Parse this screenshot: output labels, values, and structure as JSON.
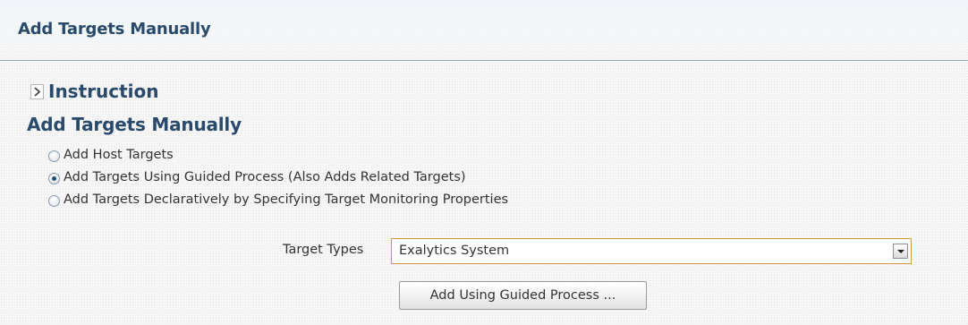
{
  "header": {
    "title": "Add Targets Manually"
  },
  "instruction": {
    "label": "Instruction",
    "icon": "chevron-right-icon"
  },
  "section": {
    "title": "Add Targets Manually"
  },
  "options": [
    {
      "label": "Add Host Targets",
      "selected": false
    },
    {
      "label": "Add Targets Using Guided Process (Also Adds Related Targets)",
      "selected": true
    },
    {
      "label": "Add Targets Declaratively by Specifying Target Monitoring Properties",
      "selected": false
    }
  ],
  "target_types": {
    "label": "Target Types",
    "selected_value": "Exalytics System"
  },
  "actions": {
    "guided_button_label": "Add Using Guided Process ..."
  },
  "colors": {
    "heading": "#2a4a6b",
    "focus_border": "#d19a45",
    "header_rule": "#9aa8b6"
  }
}
